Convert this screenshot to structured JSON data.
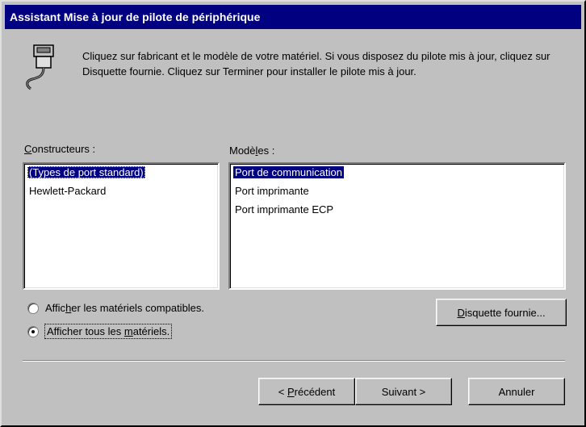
{
  "window": {
    "title": "Assistant Mise à jour de pilote de périphérique"
  },
  "intro_text": "Cliquez sur fabricant et le modèle de votre matériel. Si vous disposez du pilote mis à jour, cliquez sur Disquette fournie. Cliquez sur Terminer pour installer le pilote mis à jour.",
  "manufacturers": {
    "label_accel": "C",
    "label_rest": "onstructeurs :",
    "items": [
      "(Types de port standard)",
      "Hewlett-Packard"
    ],
    "selected_index": 0
  },
  "models": {
    "label_pre": "Modè",
    "label_accel": "l",
    "label_rest": "es :",
    "items": [
      "Port de communication",
      "Port imprimante",
      "Port imprimante ECP"
    ],
    "selected_index": 0
  },
  "radios": {
    "compatible": {
      "pre": "Affic",
      "accel": "h",
      "rest": "er les matériels compatibles.",
      "checked": false
    },
    "all": {
      "pre": "Afficher tous les ",
      "accel": "m",
      "rest": "atériels.",
      "checked": true
    }
  },
  "buttons": {
    "have_disk": {
      "accel": "D",
      "rest": "isquette fournie..."
    },
    "back": {
      "pre": "< ",
      "accel": "P",
      "rest": "récédent"
    },
    "next": "Suivant >",
    "cancel": "Annuler"
  },
  "icons": {
    "connector": "port-connector-icon"
  }
}
